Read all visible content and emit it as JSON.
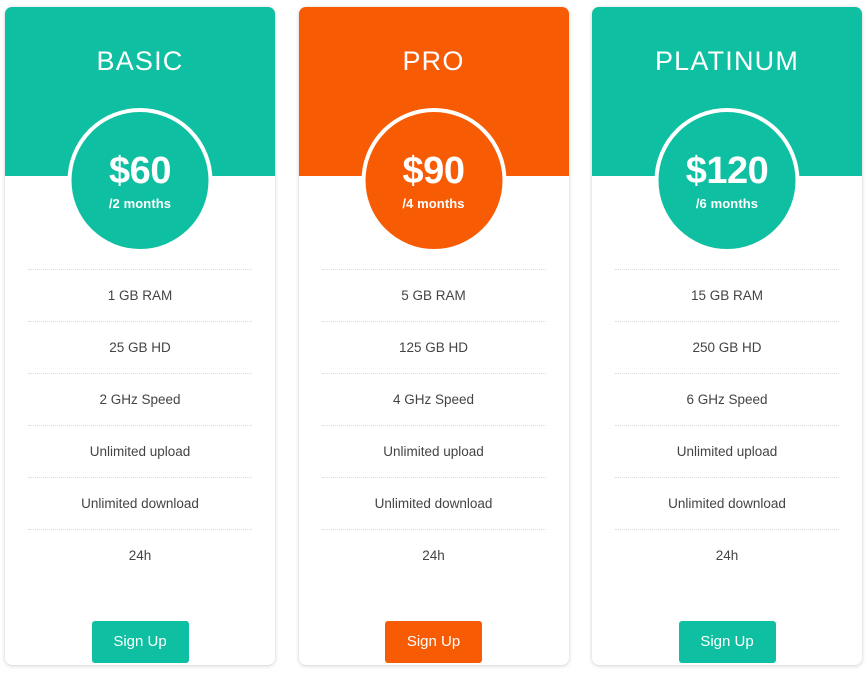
{
  "page": {
    "background_color": "#ffffff"
  },
  "colors": {
    "teal": "#0FBFA1",
    "orange": "#F75C05",
    "feature_text": "#444444",
    "divider": "#d9d9d9",
    "card_background": "#ffffff",
    "title_text": "#ffffff"
  },
  "feature_labels": {
    "ram": "RAM",
    "hd": "HD",
    "speed": "Speed",
    "upload": "Unlimited upload",
    "download": "Unlimited download",
    "support": "24h"
  },
  "plans": [
    {
      "id": "basic",
      "title": "BASIC",
      "price": "$60",
      "period": "/2 months",
      "accent": "#0FBFA1",
      "features": [
        "1 GB RAM",
        "25 GB HD",
        "2 GHz Speed",
        "Unlimited upload",
        "Unlimited download",
        "24h"
      ],
      "cta_label": "Sign Up"
    },
    {
      "id": "pro",
      "title": "PRO",
      "price": "$90",
      "period": "/4 months",
      "accent": "#F75C05",
      "features": [
        "5 GB RAM",
        "125 GB HD",
        "4 GHz Speed",
        "Unlimited upload",
        "Unlimited download",
        "24h"
      ],
      "cta_label": "Sign Up"
    },
    {
      "id": "platinum",
      "title": "PLATINUM",
      "price": "$120",
      "period": "/6 months",
      "accent": "#0FBFA1",
      "features": [
        "15 GB RAM",
        "250 GB HD",
        "6 GHz Speed",
        "Unlimited upload",
        "Unlimited download",
        "24h"
      ],
      "cta_label": "Sign Up"
    }
  ]
}
